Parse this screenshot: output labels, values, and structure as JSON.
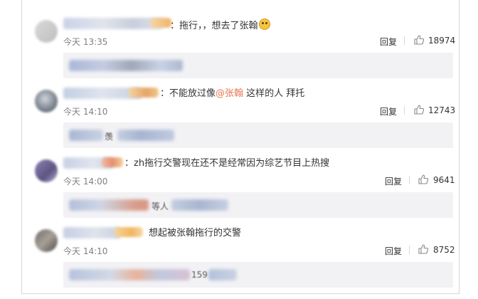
{
  "comments": [
    {
      "text": "：拖行，，想去了张翰",
      "emoji": "sad-face-emoji",
      "time": "今天 13:35",
      "reply_label": "回复",
      "likes": "18974",
      "reply_text": ""
    },
    {
      "text_pre": "：不能放过像",
      "mention": "@张翰",
      "text_post": " 这样的人 拜托",
      "time": "今天 14:10",
      "reply_label": "回复",
      "likes": "12743",
      "reply_text": "羡"
    },
    {
      "text": "：zh拖行交警现在还不是经常因为综艺节目上热搜",
      "time": "今天 14:00",
      "reply_label": "回复",
      "likes": "9641",
      "reply_text": "等人"
    },
    {
      "text": "想起被张翰拖行的交警",
      "time": "今天 14:10",
      "reply_label": "回复",
      "likes": "8752",
      "reply_text": "159"
    }
  ],
  "colors": {
    "mention": "#eb7350",
    "reply_bg": "#f2f2f5",
    "meta_text": "#808080"
  },
  "icons": {
    "like": "thumbs-up-icon",
    "separator": "divider"
  }
}
